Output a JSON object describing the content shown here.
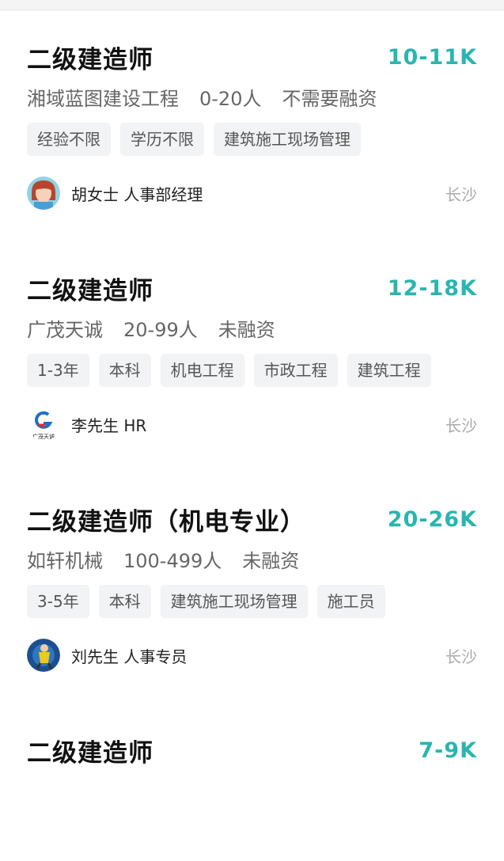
{
  "jobs": [
    {
      "title": "二级建造师",
      "salary": "10-11K",
      "company": "湘域蓝图建设工程",
      "size": "0-20人",
      "funding": "不需要融资",
      "tags": [
        "经验不限",
        "学历不限",
        "建筑施工现场管理"
      ],
      "recruiter": "胡女士 人事部经理",
      "avatar_icon": "woman-avatar-icon",
      "location": "长沙"
    },
    {
      "title": "二级建造师",
      "salary": "12-18K",
      "company": "广茂天诚",
      "size": "20-99人",
      "funding": "未融资",
      "tags": [
        "1-3年",
        "本科",
        "机电工程",
        "市政工程",
        "建筑工程"
      ],
      "recruiter": "李先生 HR",
      "avatar_icon": "company-logo-icon",
      "avatar_logo_text": "广茂天诚",
      "location": "长沙"
    },
    {
      "title": "二级建造师（机电专业）",
      "salary": "20-26K",
      "company": "如轩机械",
      "size": "100-499人",
      "funding": "未融资",
      "tags": [
        "3-5年",
        "本科",
        "建筑施工现场管理",
        "施工员"
      ],
      "recruiter": "刘先生 人事专员",
      "avatar_icon": "man-avatar-icon",
      "location": "长沙"
    },
    {
      "title": "二级建造师",
      "salary": "7-9K"
    }
  ],
  "colors": {
    "salary": "#2ab5b0",
    "tag_bg": "#f2f3f5",
    "muted": "#aaaaaa"
  }
}
